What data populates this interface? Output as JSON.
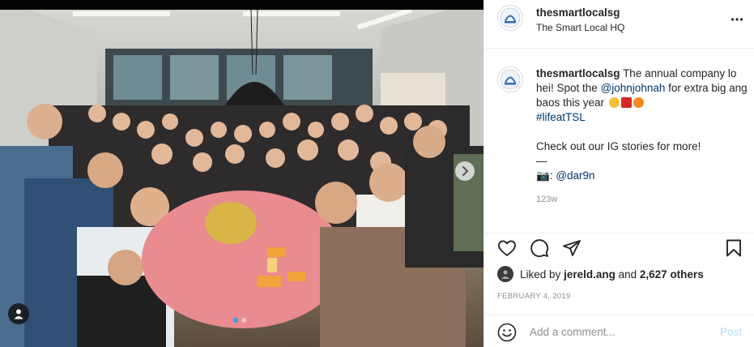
{
  "post": {
    "photo_alt_icon": "group-photo",
    "carousel_index": 1,
    "carousel_count": 2
  },
  "header": {
    "username": "thesmartlocalsg",
    "location": "The Smart Local HQ",
    "more_icon": "more-horizontal-icon"
  },
  "caption": {
    "username": "thesmartlocalsg",
    "text_1": "The annual company lo hei! Spot the",
    "mention_1": "@johnjohnah",
    "text_2": "for extra big ang baos this year",
    "hashtag": "#lifeatTSL",
    "line_2": "Check out our IG stories for more!",
    "dash": "—",
    "camera_emoji_label": "📷:",
    "mention_2": "@dar9n",
    "time": "123w"
  },
  "actions": {
    "like_icon": "heart-icon",
    "comment_icon": "comment-icon",
    "share_icon": "send-icon",
    "save_icon": "bookmark-icon"
  },
  "likes": {
    "prefix": "Liked by",
    "user": "jereld.ang",
    "and": "and",
    "others": "2,627 others"
  },
  "date": "February 4, 2019",
  "comment_box": {
    "placeholder": "Add a comment...",
    "post_label": "Post"
  },
  "colors": {
    "link": "#00376b",
    "post_disabled": "#b2dffc",
    "dot_active": "#3897f0"
  }
}
